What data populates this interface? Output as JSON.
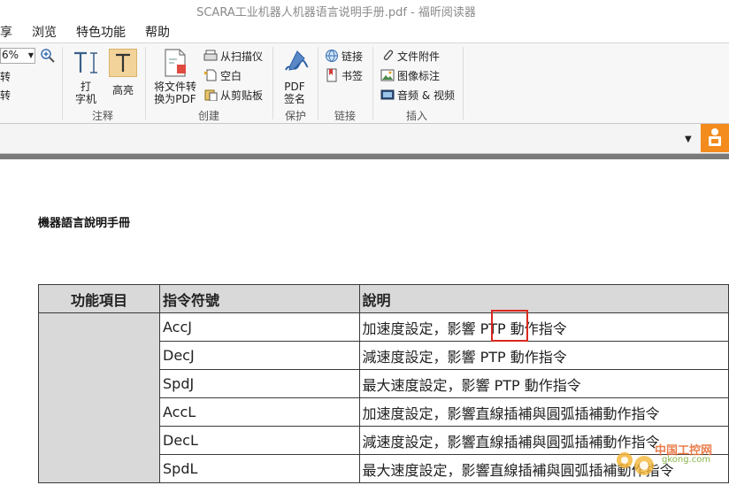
{
  "app": {
    "title": "SCARA工业机器人机器语言说明手册.pdf - 福昕阅读器"
  },
  "menu": {
    "items": [
      "享",
      "浏览",
      "特色功能",
      "帮助"
    ]
  },
  "search": {
    "value": "PTP"
  },
  "ribbon": {
    "zoom_value": "6%",
    "left_fragments": [
      "转",
      "转"
    ],
    "annotate": {
      "typewriter_label": "打\n字机",
      "highlight_label": "高亮",
      "group": "注释"
    },
    "create": {
      "convert_label": "将文件转\n换为PDF",
      "from_scanner": "从扫描仪",
      "blank": "空白",
      "from_clipboard": "从剪贴板",
      "group": "创建"
    },
    "protect": {
      "sign_label": "PDF\n签名",
      "group": "保护"
    },
    "links": {
      "link": "链接",
      "bookmark": "书签",
      "group": "链接"
    },
    "insert": {
      "file_attachment": "文件附件",
      "image_annotation": "图像标注",
      "audio_video": "音频 & 视频",
      "group": "插入"
    }
  },
  "document": {
    "heading": "機器語言說明手冊",
    "table": {
      "headers": [
        "功能項目",
        "指令符號",
        "說明"
      ],
      "rows": [
        {
          "symbol": "AccJ",
          "desc": "加速度設定，影響 PTP 動作指令"
        },
        {
          "symbol": "DecJ",
          "desc": "減速度設定，影響 PTP 動作指令"
        },
        {
          "symbol": "SpdJ",
          "desc": "最大速度設定，影響 PTP 動作指令"
        },
        {
          "symbol": "AccL",
          "desc": "加速度設定，影響直線插補與圓弧插補動作指令"
        },
        {
          "symbol": "DecL",
          "desc": "減速度設定，影響直線插補與圓弧插補動作指令"
        },
        {
          "symbol": "SpdL",
          "desc": "最大速度設定，影響直線插補與圓弧插補動作指令"
        }
      ]
    }
  },
  "watermark": {
    "text1": "中国工控网",
    "text2": "gkong.com"
  },
  "colors": {
    "accent_orange": "#f38b1d",
    "highlight_box": "#d9281f",
    "table_header_bg": "#d9d9d9"
  }
}
